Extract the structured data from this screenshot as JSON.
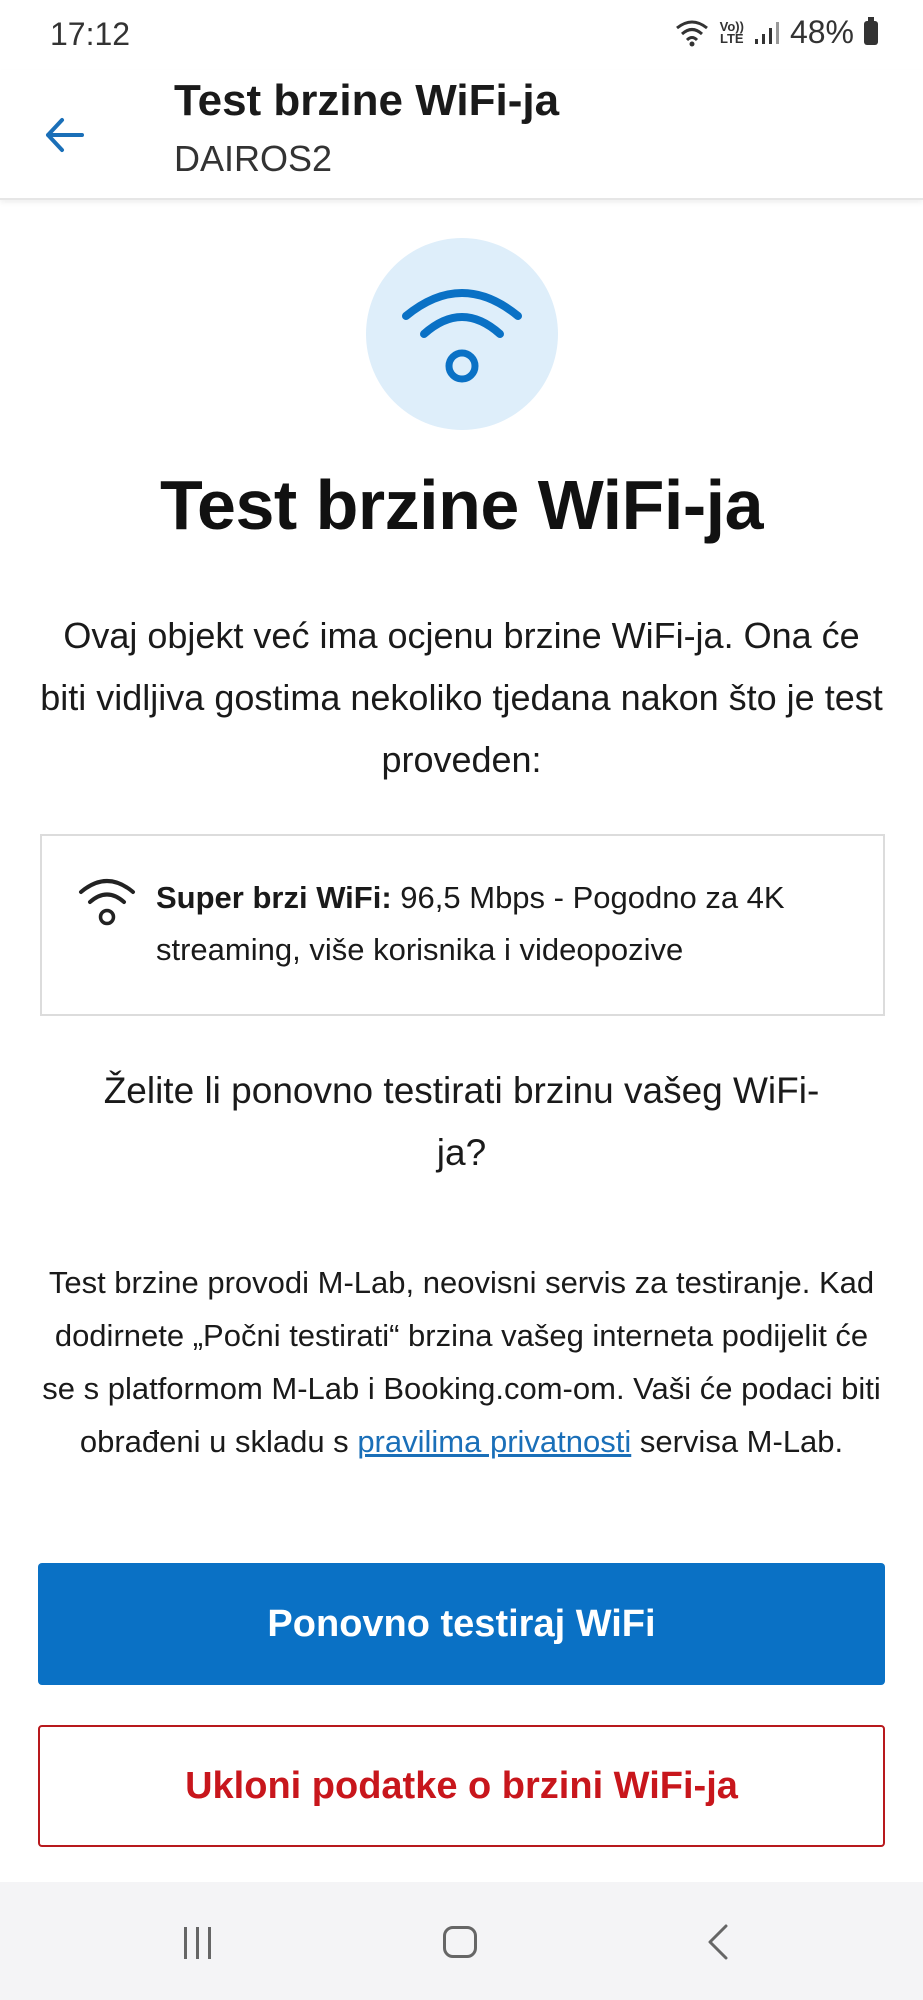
{
  "status_bar": {
    "time": "17:12",
    "network_label_top": "Vo))",
    "network_label_bottom": "LTE",
    "battery": "48%"
  },
  "header": {
    "title": "Test brzine WiFi-ja",
    "subtitle": "DAIROS2"
  },
  "main": {
    "headline": "Test brzine WiFi-ja",
    "intro": "Ovaj objekt već ima ocjenu brzine WiFi-ja. Ona će biti vidljiva gostima nekoliko tjedana nakon što je test proveden:",
    "speed_card": {
      "label": "Super brzi WiFi:",
      "description": "96,5 Mbps - Pogodno za 4K streaming, više korisnika i videopozive"
    },
    "question": "Želite li ponovno testirati brzinu vašeg WiFi-ja?",
    "disclaimer_before": "Test brzine provodi M-Lab, neovisni servis za testiranje. Kad dodirnete „Počni testirati“ brzina vašeg interneta podijelit će se s platformom M-Lab i Booking.com-om. Vaši će podaci biti obrađeni u skladu s ",
    "privacy_link": "pravilima privatnosti",
    "disclaimer_after": " servisa M-Lab.",
    "retest_button": "Ponovno testiraj WiFi",
    "remove_button": "Ukloni podatke o brzini WiFi-ja"
  },
  "icons": {
    "back": "arrow-left-icon",
    "hero": "wifi-icon",
    "card": "wifi-icon"
  },
  "colors": {
    "accent": "#0a71c5",
    "hero_bg": "#deeefa",
    "danger": "#c8161c",
    "link": "#1a6fb8"
  }
}
